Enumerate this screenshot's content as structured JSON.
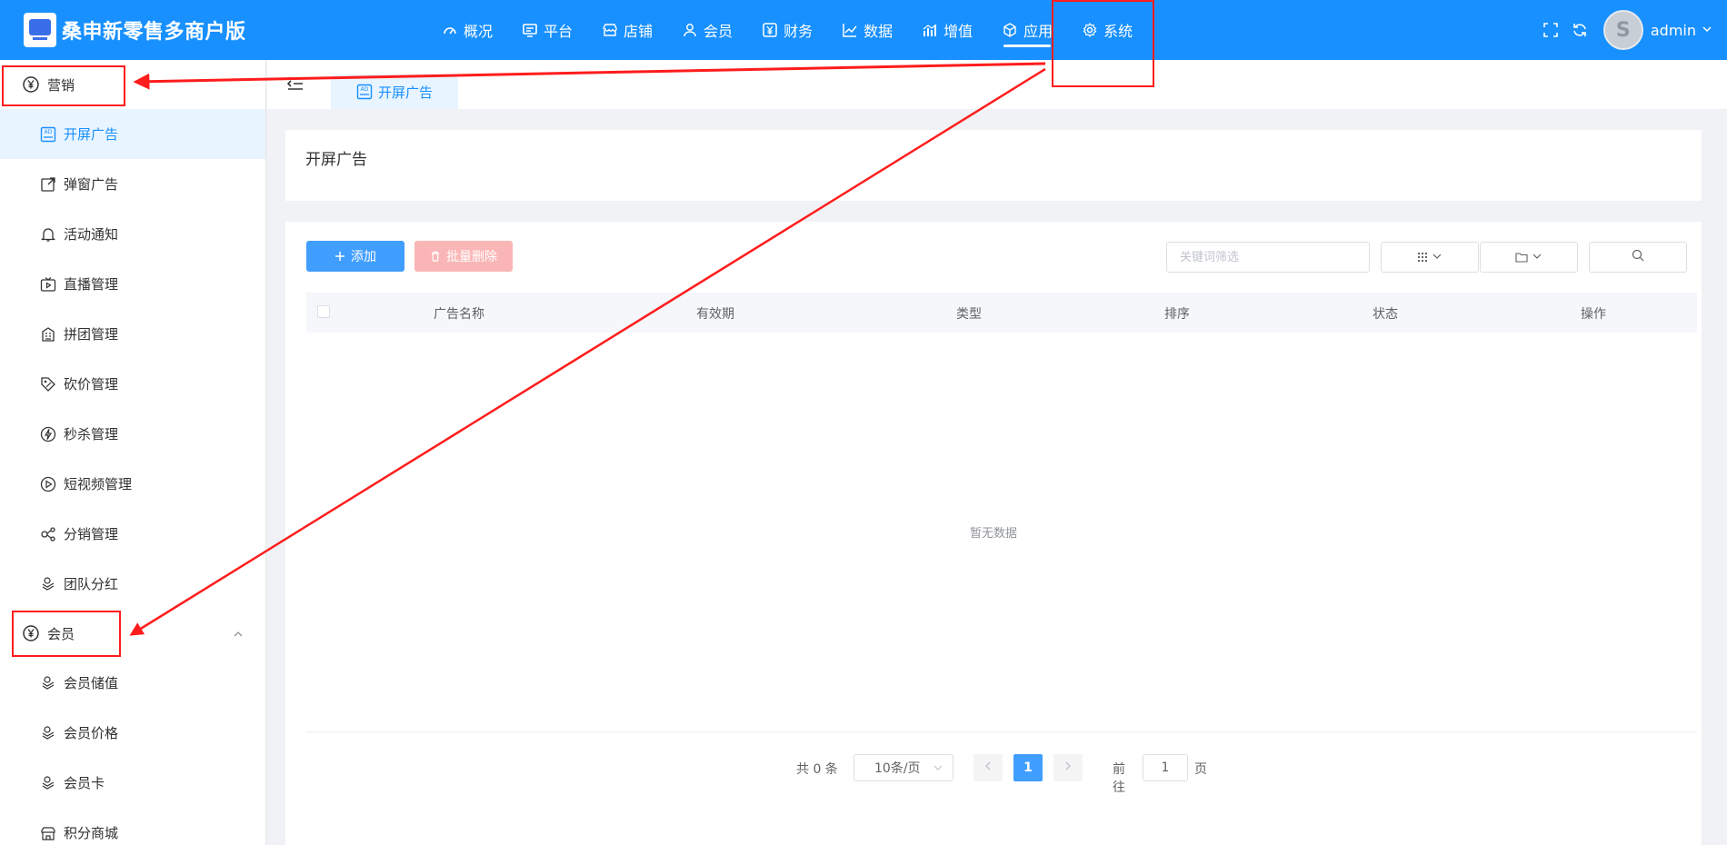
{
  "header": {
    "brand_title": "桑申新零售多商户版",
    "nav": [
      {
        "label": "概况",
        "icon": "dashboard-icon"
      },
      {
        "label": "平台",
        "icon": "monitor-icon"
      },
      {
        "label": "店铺",
        "icon": "store-icon"
      },
      {
        "label": "会员",
        "icon": "user-icon"
      },
      {
        "label": "财务",
        "icon": "yen-icon"
      },
      {
        "label": "数据",
        "icon": "line-chart-icon"
      },
      {
        "label": "增值",
        "icon": "bar-chart-icon"
      },
      {
        "label": "应用",
        "icon": "cube-icon",
        "active": true
      },
      {
        "label": "系统",
        "icon": "gear-icon"
      }
    ],
    "username": "admin",
    "avatar_letter": "S"
  },
  "sidebar": {
    "group_marketing": "营销",
    "marketing_items": [
      {
        "label": "开屏广告",
        "icon": "ad-icon",
        "active": true
      },
      {
        "label": "弹窗广告",
        "icon": "popup-icon"
      },
      {
        "label": "活动通知",
        "icon": "bell-icon"
      },
      {
        "label": "直播管理",
        "icon": "tv-icon"
      },
      {
        "label": "拼团管理",
        "icon": "building-icon"
      },
      {
        "label": "砍价管理",
        "icon": "tag-icon"
      },
      {
        "label": "秒杀管理",
        "icon": "lightning-icon"
      },
      {
        "label": "短视频管理",
        "icon": "play-icon"
      },
      {
        "label": "分销管理",
        "icon": "share-icon"
      },
      {
        "label": "团队分红",
        "icon": "coins-icon"
      }
    ],
    "group_member": "会员",
    "member_items": [
      {
        "label": "会员储值",
        "icon": "coins-icon"
      },
      {
        "label": "会员价格",
        "icon": "coins-icon"
      },
      {
        "label": "会员卡",
        "icon": "coins-icon"
      },
      {
        "label": "积分商城",
        "icon": "shop-icon"
      }
    ]
  },
  "tabs": [
    {
      "label": "开屏广告",
      "icon": "ad-icon"
    }
  ],
  "page": {
    "title": "开屏广告"
  },
  "toolbar": {
    "add_label": "添加",
    "batch_delete_label": "批量删除",
    "search_placeholder": "关键词筛选"
  },
  "table": {
    "columns": [
      "广告名称",
      "有效期",
      "类型",
      "排序",
      "状态",
      "操作"
    ],
    "empty_text": "暂无数据"
  },
  "pagination": {
    "total_text": "共 0 条",
    "page_size": "10条/页",
    "current_page": "1",
    "goto_label": "前往",
    "goto_value": "1",
    "page_unit": "页"
  },
  "colors": {
    "primary": "#1890ff",
    "button_blue": "#409eff",
    "button_danger_disabled": "#fab6b6",
    "annotation_red": "#ff1c1c"
  }
}
